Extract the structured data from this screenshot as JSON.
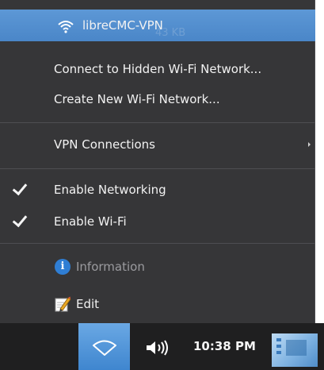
{
  "menu": {
    "active_network": {
      "label": "libreCMC-VPN",
      "background_text": "43 KB"
    },
    "hidden_network": {
      "label": "Connect to Hidden Wi-Fi Network..."
    },
    "create_network": {
      "label": "Create New Wi-Fi Network..."
    },
    "vpn_connections": {
      "label": "VPN Connections"
    },
    "enable_networking": {
      "label": "Enable Networking",
      "checked": true
    },
    "enable_wifi": {
      "label": "Enable Wi-Fi",
      "checked": true
    },
    "information": {
      "label": "Information",
      "icon": "info-icon",
      "enabled": false
    },
    "edit": {
      "label": "Edit",
      "icon": "edit-icon"
    }
  },
  "taskbar": {
    "wifi_icon": "wifi-icon",
    "volume_icon": "volume-icon",
    "clock": "10:38 PM",
    "desktop_icon": "show-desktop-icon"
  },
  "colors": {
    "menu_bg": "#363638",
    "highlight": "#4a86c8",
    "taskbar_bg": "#1f1f20",
    "text": "#f2f2f2",
    "disabled_text": "#9b9b9f"
  }
}
